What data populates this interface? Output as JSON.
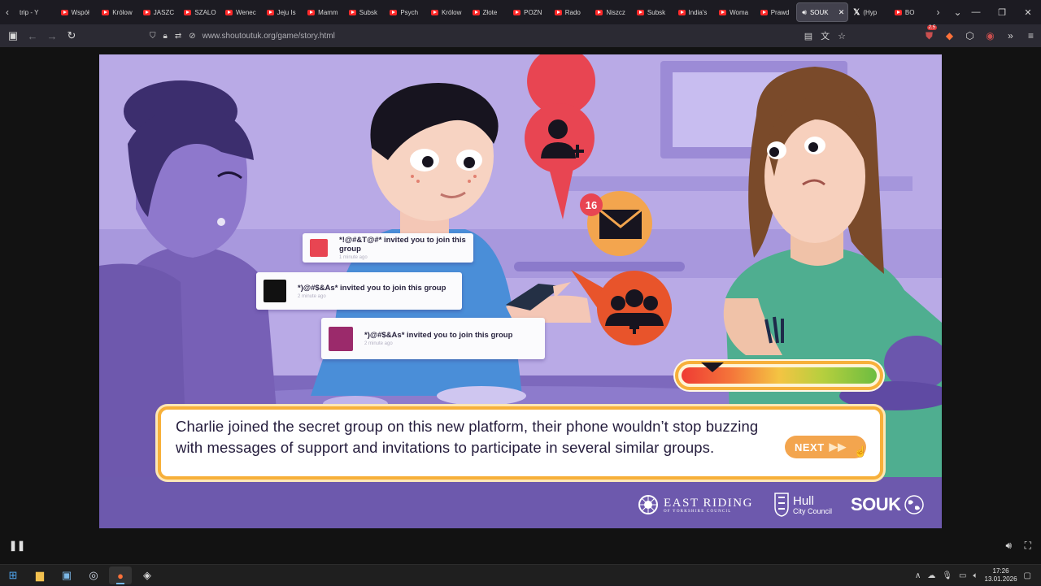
{
  "browser": {
    "tabs": [
      {
        "label": "trip - Y",
        "icon": "none"
      },
      {
        "label": "Współ",
        "icon": "youtube-icon"
      },
      {
        "label": "Królow",
        "icon": "youtube-icon"
      },
      {
        "label": "JASZC",
        "icon": "youtube-icon"
      },
      {
        "label": "SZALO",
        "icon": "youtube-icon"
      },
      {
        "label": "Wenec",
        "icon": "youtube-icon"
      },
      {
        "label": "Jeju Is",
        "icon": "youtube-icon"
      },
      {
        "label": "Mamm",
        "icon": "youtube-icon"
      },
      {
        "label": "Subsk",
        "icon": "youtube-icon"
      },
      {
        "label": "Psych",
        "icon": "youtube-icon"
      },
      {
        "label": "Królow",
        "icon": "youtube-icon"
      },
      {
        "label": "Złote",
        "icon": "youtube-icon"
      },
      {
        "label": "POZN",
        "icon": "youtube-icon"
      },
      {
        "label": "Rado",
        "icon": "youtube-icon"
      },
      {
        "label": "Niszcz",
        "icon": "youtube-icon"
      },
      {
        "label": "Subsk",
        "icon": "youtube-icon"
      },
      {
        "label": "India's",
        "icon": "youtube-icon"
      },
      {
        "label": "Woma",
        "icon": "youtube-icon"
      },
      {
        "label": "Prawd",
        "icon": "youtube-icon"
      }
    ],
    "active_tab": {
      "label": "SOUK",
      "icon": "speaker-icon"
    },
    "after_tabs": [
      {
        "label": "(Hyp",
        "icon": "x-logo-icon"
      },
      {
        "label": "BO",
        "icon": "youtube-icon"
      }
    ],
    "url": "www.shoutoutuk.org/game/story.html",
    "ext_badges": {
      "shield_count": "2.5"
    }
  },
  "game": {
    "notifications": [
      {
        "text": "*!@#&T@#* invited you to join this group",
        "time": "1 minute ago",
        "color": "#e84552"
      },
      {
        "text": "*)@#$&As* invited you to join this group",
        "time": "2 minute ago",
        "color": "#111111"
      },
      {
        "text": "*)@#$&As* invited you to join this group",
        "time": "2 minute ago",
        "color": "#9b2a6b"
      }
    ],
    "message_count": "16",
    "dialog": "Charlie joined the secret group on this new platform, their phone wouldn’t stop buzzing with messages of support and invitations to participate in several similar groups.",
    "next_label": "NEXT",
    "meter": {
      "value": 0.1,
      "colors": [
        "#ef3b34",
        "#f4c443",
        "#6dbd40"
      ]
    },
    "logos": {
      "east_riding_1": "EAST RIDING",
      "east_riding_2": "OF YORKSHIRE COUNCIL",
      "hull_1": "Hull",
      "hull_2": "City Council",
      "souk": "SOUK"
    }
  },
  "taskbar": {
    "time": "17:26",
    "date": "13.01.2026"
  }
}
